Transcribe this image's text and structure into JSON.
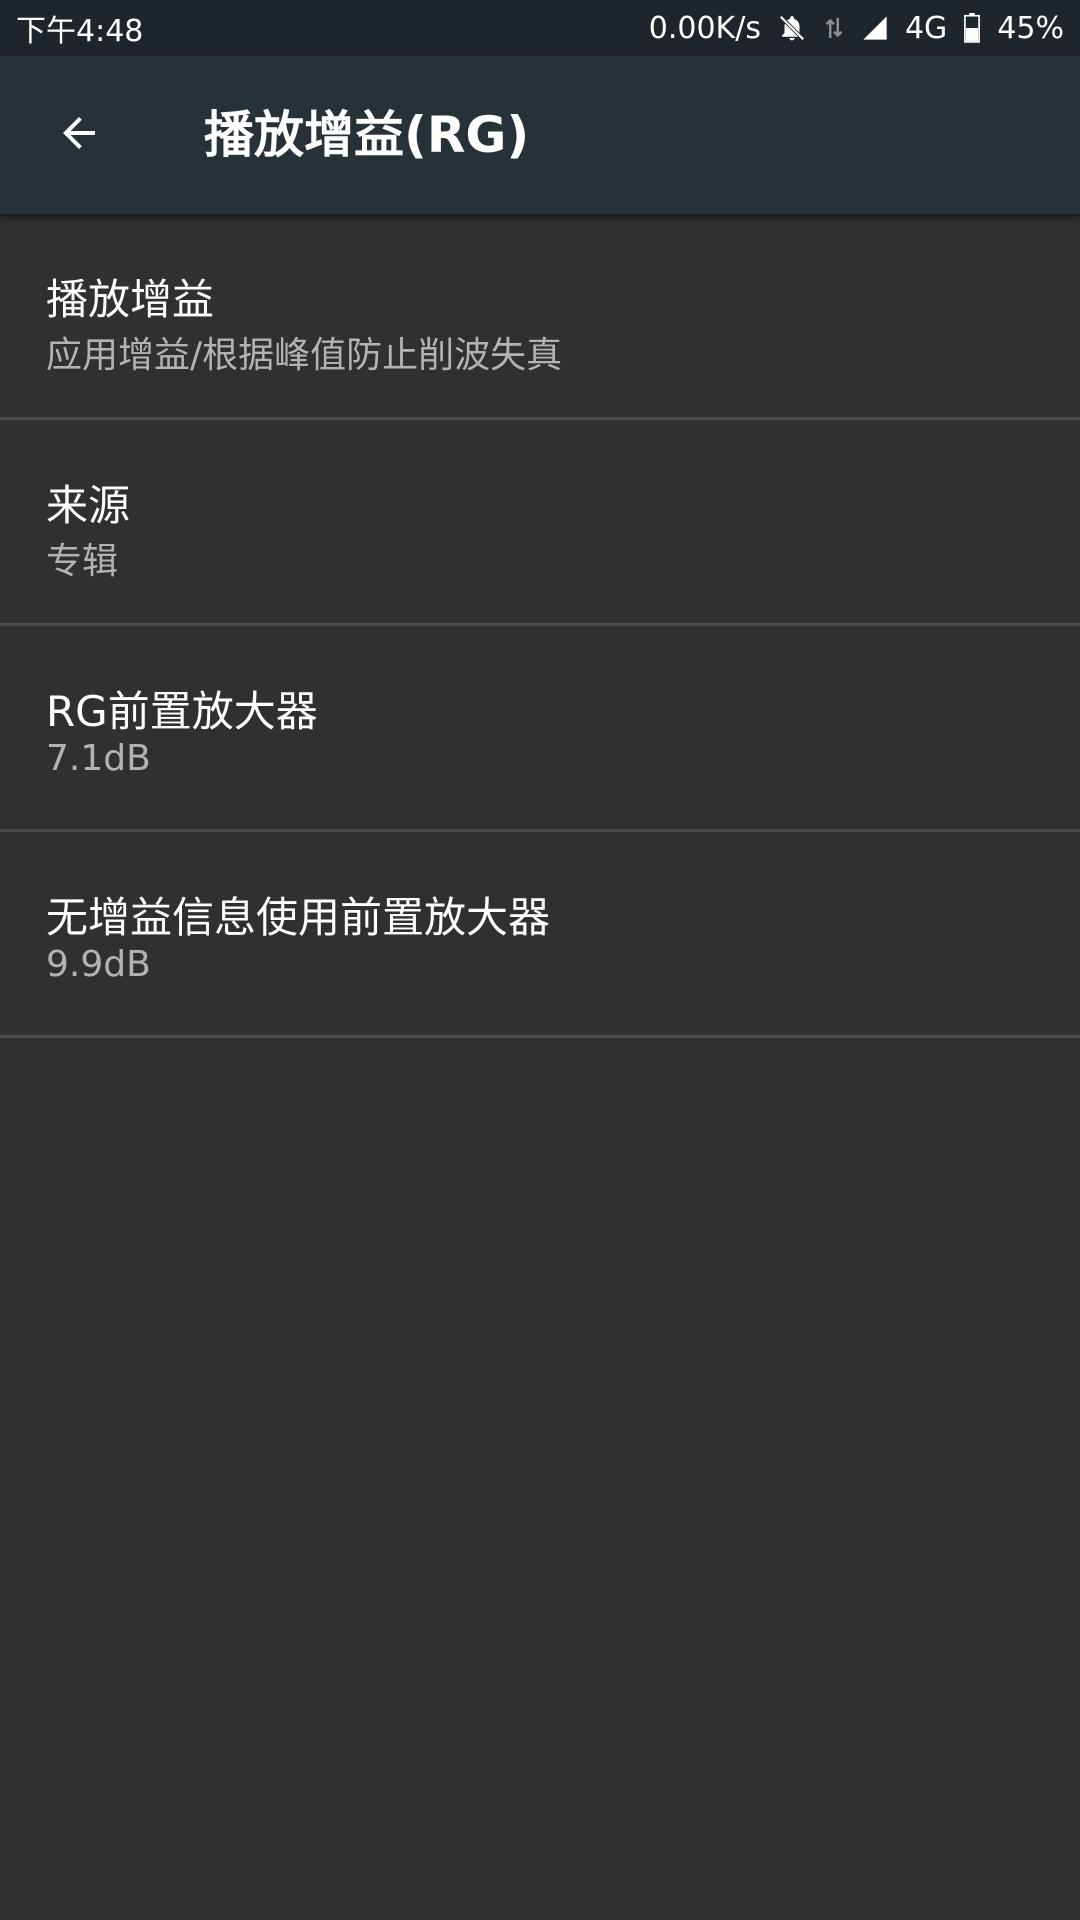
{
  "status_bar": {
    "time": "下午4:48",
    "net_speed": "0.00K/s",
    "network_type": "4G",
    "battery": "45%",
    "icons": [
      "bell-off-icon",
      "data-arrows-icon",
      "signal-icon",
      "battery-icon"
    ]
  },
  "app_bar": {
    "title": "播放增益(RG)",
    "back_icon": "arrow-left-icon"
  },
  "settings": [
    {
      "title": "播放增益",
      "summary": "应用增益/根据峰值防止削波失真"
    },
    {
      "title": "来源",
      "summary": "专辑"
    },
    {
      "title": "RG前置放大器",
      "summary": "7.1dB"
    },
    {
      "title": "无增益信息使用前置放大器",
      "summary": "9.9dB"
    }
  ],
  "colors": {
    "status_bar_bg": "#1e252b",
    "app_bar_bg": "#263238",
    "page_bg": "#303030",
    "divider": "#4a4a4a",
    "title_text": "#ffffff",
    "summary_text": "#b3b3b3"
  }
}
